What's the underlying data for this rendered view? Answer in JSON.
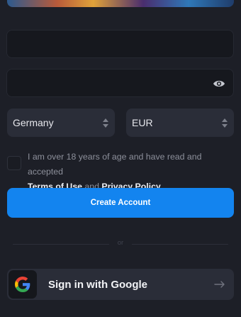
{
  "form": {
    "email_value": "",
    "password_value": "",
    "country": {
      "selected": "Germany"
    },
    "currency": {
      "selected": "EUR"
    },
    "terms": {
      "prefix": "I am over 18 years of age and have read and accepted",
      "terms_link": "Terms of Use",
      "conjunction": "and",
      "privacy_link": "Privacy Policy"
    },
    "create_button": "Create Account",
    "divider_text": "or",
    "google_button": "Sign in with Google"
  },
  "icons": {
    "eye": "eye-icon",
    "select_arrows": "chevron-updown-icon",
    "google": "google-icon",
    "arrow": "arrow-right-icon"
  },
  "colors": {
    "background": "#1d1f27",
    "input_bg": "#16181e",
    "select_bg": "#2a2d38",
    "primary": "#1384ef"
  }
}
